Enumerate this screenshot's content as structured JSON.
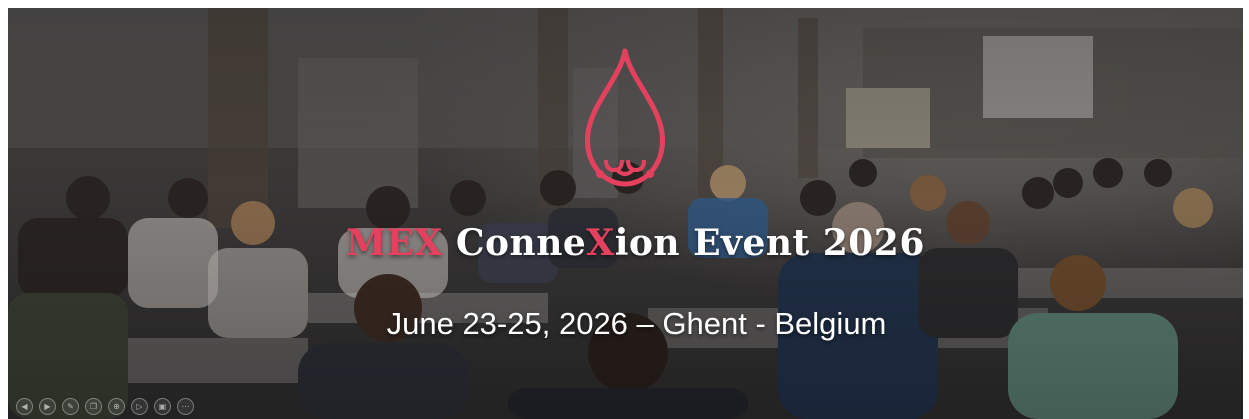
{
  "banner": {
    "title_parts": [
      {
        "text": "MEX",
        "accent": true
      },
      {
        "text": " Conne",
        "accent": false
      },
      {
        "text": "X",
        "accent": true
      },
      {
        "text": "ion Event 2026",
        "accent": false
      }
    ],
    "subtitle": "June 23-25, 2026 – Ghent - Belgium",
    "logo_icon": "droplet-logo-icon",
    "colors": {
      "accent": "#e5415f",
      "text": "#ffffff"
    }
  },
  "controls": [
    {
      "icon": "back-icon",
      "glyph": "◀"
    },
    {
      "icon": "play-icon",
      "glyph": "▶"
    },
    {
      "icon": "pen-icon",
      "glyph": "✎"
    },
    {
      "icon": "copy-icon",
      "glyph": "❐"
    },
    {
      "icon": "zoom-icon",
      "glyph": "⊕"
    },
    {
      "icon": "forward-icon",
      "glyph": "▷"
    },
    {
      "icon": "camera-icon",
      "glyph": "▣"
    },
    {
      "icon": "more-icon",
      "glyph": "⋯"
    }
  ]
}
